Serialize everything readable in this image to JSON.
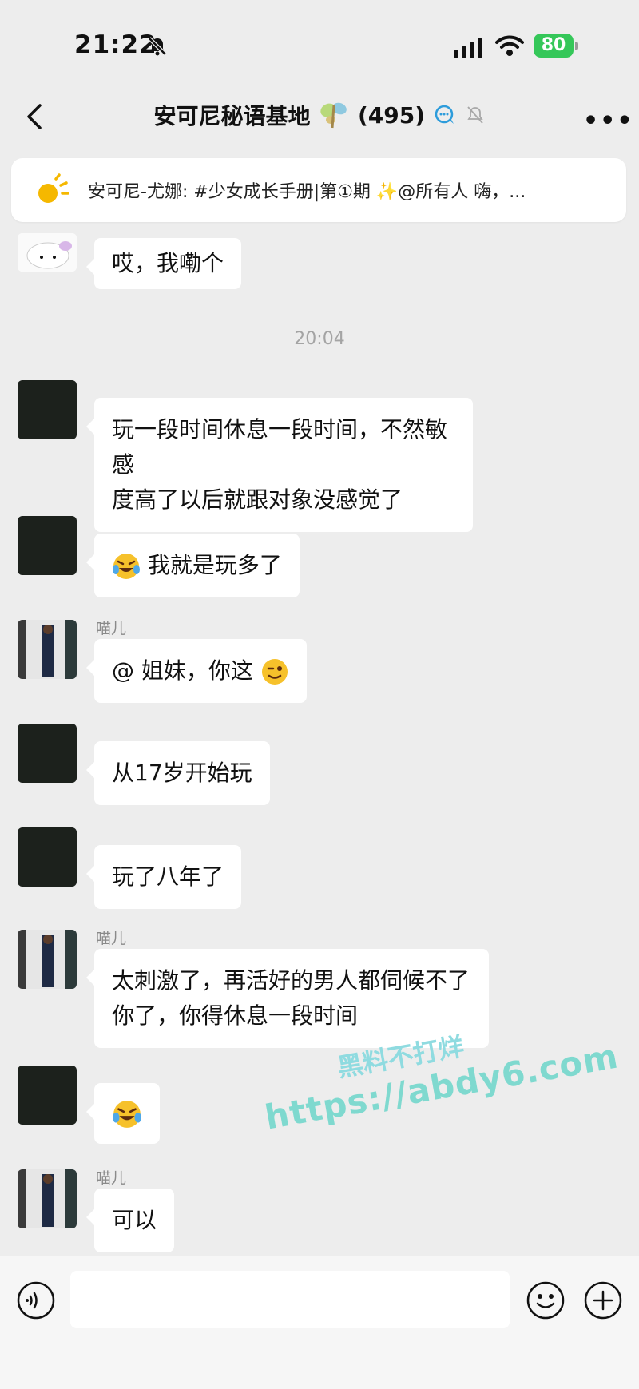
{
  "status_bar": {
    "time": "21:22",
    "battery": "80"
  },
  "header": {
    "title": "安可尼秘语基地",
    "member_count": "(495)"
  },
  "notice": {
    "text": "安可尼-尤娜: #少女成长手册|第①期 ✨@所有人 嗨，..."
  },
  "timestamp": "20:04",
  "messages": [
    {
      "text": "哎，我嘞个"
    },
    {
      "text_line1": "玩一段时间休息一段时间，不然敏感",
      "text_line2": "度高了以后就跟对象没感觉了"
    },
    {
      "text": "我就是玩多了"
    },
    {
      "sender": "喵儿",
      "text": "@ 姐妹，你这"
    },
    {
      "text": "从17岁开始玩"
    },
    {
      "text": "玩了八年了"
    },
    {
      "sender": "喵儿",
      "text_line1": "太刺激了，再活好的男人都伺候不了",
      "text_line2": "你了，你得休息一段时间"
    },
    {
      "text": ""
    },
    {
      "sender": "喵儿",
      "text": "可以"
    }
  ],
  "watermark": {
    "line1": "黑料不打烊",
    "line2": "https://abdy6.com"
  },
  "icons": [
    "bell-off-icon",
    "signal-icon",
    "wifi-icon",
    "back-icon",
    "butterfly-icon",
    "chat-bubble-icon",
    "mute-icon",
    "more-icon",
    "sun-icon",
    "laugh-cry-emoji",
    "wink-emoji",
    "voice-icon",
    "smile-icon",
    "plus-icon"
  ]
}
